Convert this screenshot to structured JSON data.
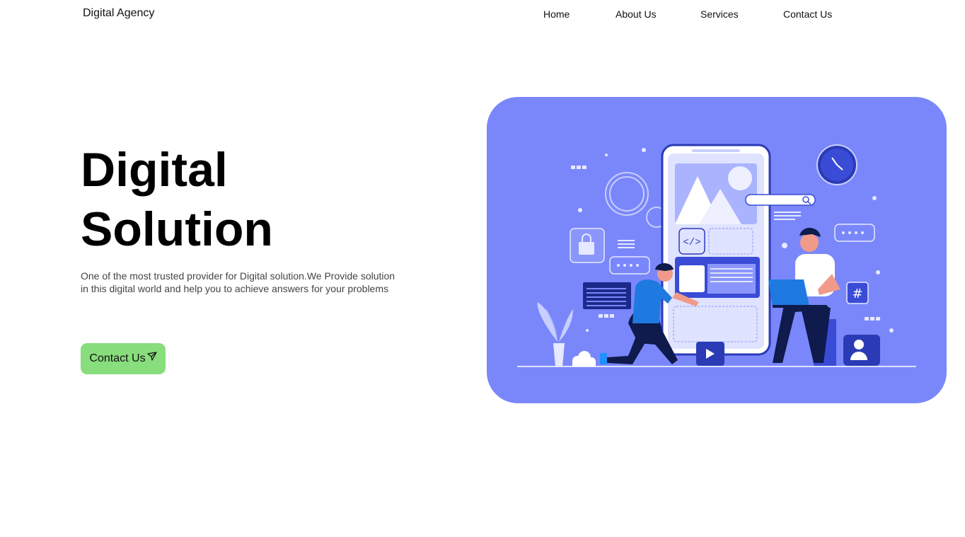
{
  "header": {
    "brand": "Digital Agency",
    "nav": [
      {
        "label": "Home"
      },
      {
        "label": "About Us"
      },
      {
        "label": "Services"
      },
      {
        "label": "Contact Us"
      }
    ]
  },
  "hero": {
    "title_line1": "Digital",
    "title_line2": "Solution",
    "description_line1": "One of the most trusted provider for Digital solution.We Provide solution",
    "description_line2": "in this digital world and help you to achieve answers for your problems",
    "cta_label": "Contact Us",
    "cta_icon": "send-icon"
  },
  "illustration": {
    "background_color": "#7a87fb",
    "subject": "two people building a mobile app"
  }
}
